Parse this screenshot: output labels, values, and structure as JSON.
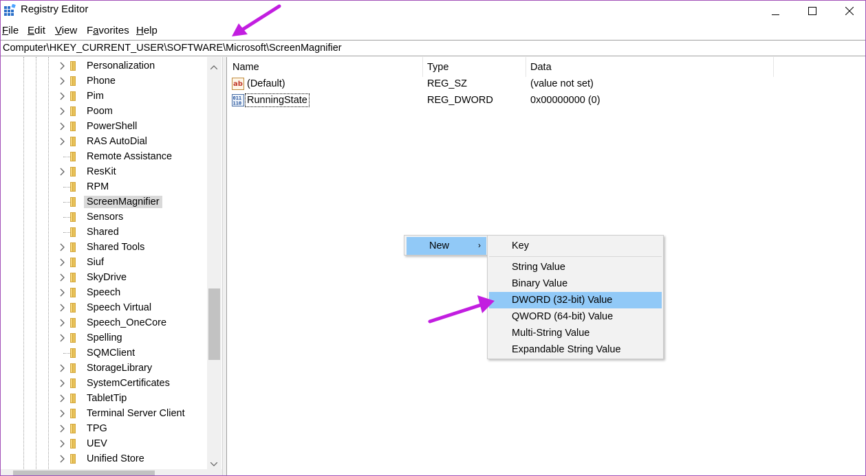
{
  "window": {
    "title": "Registry Editor",
    "minimize_icon": "minimize-icon",
    "maximize_icon": "maximize-icon",
    "close_icon": "close-icon"
  },
  "menu": [
    {
      "underline": "F",
      "rest": "ile"
    },
    {
      "underline": "E",
      "rest": "dit"
    },
    {
      "underline": "V",
      "rest": "iew"
    },
    {
      "underline": "",
      "pre": "F",
      "underline2": "a",
      "rest": "vorites"
    },
    {
      "underline": "H",
      "rest": "elp"
    }
  ],
  "menu_labels": {
    "file": "File",
    "edit": "Edit",
    "view": "View",
    "favorites": "Favorites",
    "help": "Help"
  },
  "address": "Computer\\HKEY_CURRENT_USER\\SOFTWARE\\Microsoft\\ScreenMagnifier",
  "tree": {
    "items": [
      {
        "label": "Personalization",
        "expandable": true
      },
      {
        "label": "Phone",
        "expandable": true
      },
      {
        "label": "Pim",
        "expandable": true
      },
      {
        "label": "Poom",
        "expandable": true
      },
      {
        "label": "PowerShell",
        "expandable": true
      },
      {
        "label": "RAS AutoDial",
        "expandable": true
      },
      {
        "label": "Remote Assistance",
        "expandable": false
      },
      {
        "label": "ResKit",
        "expandable": true
      },
      {
        "label": "RPM",
        "expandable": false
      },
      {
        "label": "ScreenMagnifier",
        "expandable": false,
        "selected": true
      },
      {
        "label": "Sensors",
        "expandable": false
      },
      {
        "label": "Shared",
        "expandable": false
      },
      {
        "label": "Shared Tools",
        "expandable": true
      },
      {
        "label": "Siuf",
        "expandable": true
      },
      {
        "label": "SkyDrive",
        "expandable": true
      },
      {
        "label": "Speech",
        "expandable": true
      },
      {
        "label": "Speech Virtual",
        "expandable": true
      },
      {
        "label": "Speech_OneCore",
        "expandable": true
      },
      {
        "label": "Spelling",
        "expandable": true
      },
      {
        "label": "SQMClient",
        "expandable": false
      },
      {
        "label": "StorageLibrary",
        "expandable": true
      },
      {
        "label": "SystemCertificates",
        "expandable": true
      },
      {
        "label": "TabletTip",
        "expandable": true
      },
      {
        "label": "Terminal Server Client",
        "expandable": true
      },
      {
        "label": "TPG",
        "expandable": true
      },
      {
        "label": "UEV",
        "expandable": true
      },
      {
        "label": "Unified Store",
        "expandable": true
      }
    ]
  },
  "list": {
    "columns": [
      "Name",
      "Type",
      "Data"
    ],
    "rows": [
      {
        "icon": "string-value-icon",
        "name": "(Default)",
        "type": "REG_SZ",
        "data": "(value not set)"
      },
      {
        "icon": "binary-value-icon",
        "name": "RunningState",
        "type": "REG_DWORD",
        "data": "0x00000000 (0)"
      }
    ]
  },
  "context_menu": {
    "new_label": "New",
    "submenu": [
      "Key",
      "String Value",
      "Binary Value",
      "DWORD (32-bit) Value",
      "QWORD (64-bit) Value",
      "Multi-String Value",
      "Expandable String Value"
    ],
    "highlighted": "DWORD (32-bit) Value"
  },
  "colors": {
    "highlight": "#91c9f7",
    "annotation_arrow": "#c21ee0",
    "folder": "#e8c25a"
  }
}
